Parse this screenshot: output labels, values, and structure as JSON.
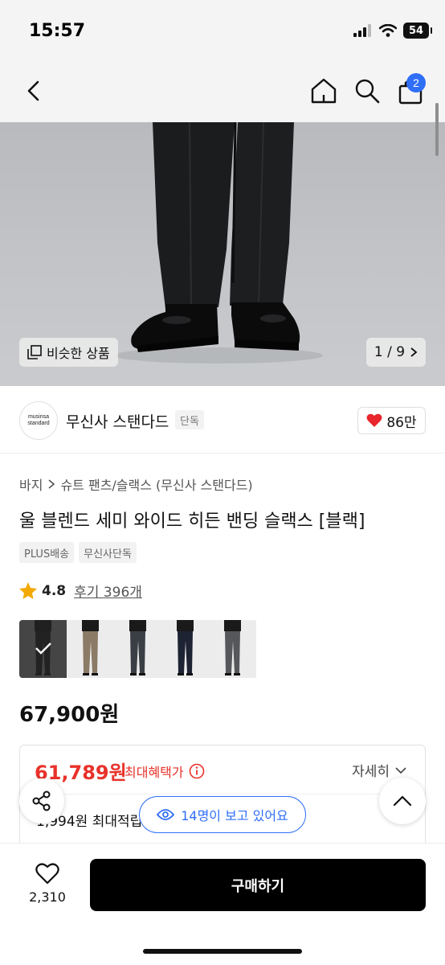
{
  "status_bar": {
    "time": "15:57",
    "battery": "54"
  },
  "nav": {
    "cart_count": "2"
  },
  "hero": {
    "similar_label": "비슷한 상품",
    "page_indicator": "1 / 9"
  },
  "brand": {
    "logo_line1": "musinsa",
    "logo_line2": "standard",
    "name": "무신사 스탠다드",
    "tag": "단독",
    "likes": "86만"
  },
  "product": {
    "breadcrumb": [
      "바지",
      "슈트 팬츠/슬랙스 (무신사 스탠다드)"
    ],
    "title": "울 블렌드 세미 와이드 히든 밴딩 슬랙스 [블랙]",
    "tags": [
      "PLUS배송",
      "무신사단독"
    ],
    "rating": "4.8",
    "reviews": "후기 396개",
    "price": "67,900원"
  },
  "color_options": [
    {
      "color": "black",
      "top": "#111111",
      "pants": "#141414",
      "bg": "#4a4a4a",
      "selected": true
    },
    {
      "color": "beige",
      "top": "#1a1a1a",
      "pants": "#8a7a66",
      "bg": "#ececec",
      "selected": false
    },
    {
      "color": "charcoal",
      "top": "#1a1a1a",
      "pants": "#3a3f45",
      "bg": "#ececec",
      "selected": false
    },
    {
      "color": "navy",
      "top": "#1a1a1a",
      "pants": "#1d2333",
      "bg": "#ececec",
      "selected": false
    },
    {
      "color": "gray",
      "top": "#1a1a1a",
      "pants": "#55575a",
      "bg": "#ececec",
      "selected": false
    }
  ],
  "benefit": {
    "sale_price": "61,789원",
    "sale_label": "최대혜택가",
    "detail_label": "자세히",
    "points_text": "1,994원 최대적립"
  },
  "viewers": {
    "text": "14명이 보고 있어요"
  },
  "bottom": {
    "wish_count": "2,310",
    "buy_label": "구매하기"
  },
  "colors": {
    "accent_blue": "#2f6ef7",
    "sale_red": "#e8322a",
    "heart_red": "#e8262c"
  }
}
